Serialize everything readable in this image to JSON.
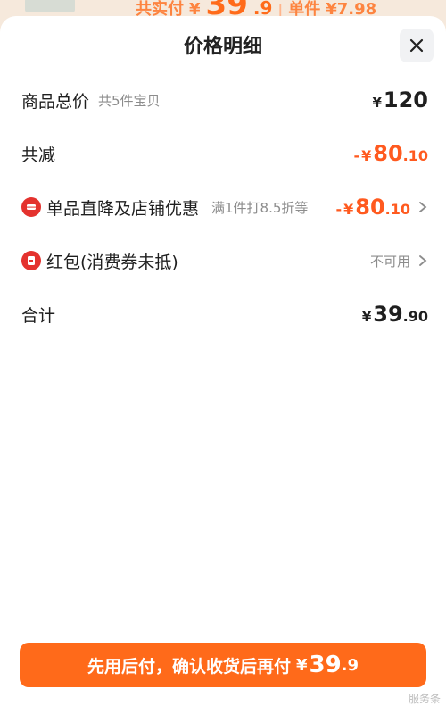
{
  "background": {
    "partial_price": {
      "pay_label": "共实付",
      "currency": "¥",
      "amount_int": "39",
      "amount_dec": ".9",
      "separator": "|",
      "unit_label": "单件",
      "unit_price": "¥7.98"
    }
  },
  "sheet": {
    "title": "价格明细",
    "rows": [
      {
        "label": "商品总价",
        "sub": "共5件宝贝",
        "price": {
          "currency": "¥",
          "int": "120",
          "dec": ""
        }
      },
      {
        "label": "共减",
        "price": {
          "prefix": "-",
          "currency": "¥",
          "int": "80",
          "dec": ".10"
        }
      },
      {
        "label": "单品直降及店铺优惠",
        "sub": "满1件打8.5折等",
        "price": {
          "prefix": "-",
          "currency": "¥",
          "int": "80",
          "dec": ".10"
        }
      },
      {
        "label": "红包(消费券未抵)",
        "status": "不可用"
      },
      {
        "label": "合计",
        "price": {
          "currency": "¥",
          "int": "39",
          "dec": ".90"
        }
      }
    ]
  },
  "cta": {
    "text": "先用后付，确认收货后再付",
    "currency": "¥",
    "amount_int": "39",
    "amount_dec": ".9"
  },
  "watermark": "服务条"
}
